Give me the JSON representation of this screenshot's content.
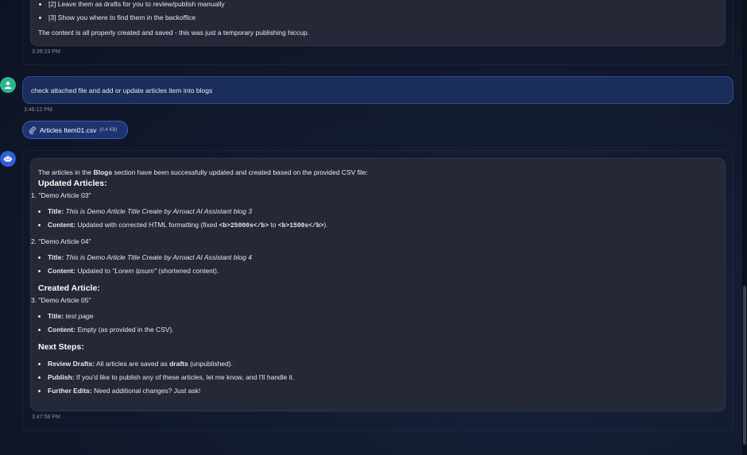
{
  "prev_message": {
    "bullet_2": "[2] Leave them as drafts for you to review/publish manually",
    "bullet_3": "[3] Show you where to find them in the backoffice",
    "summary": "The content is all properly created and saved - this was just a temporary publishing hiccup.",
    "timestamp": "3:39:23 PM"
  },
  "user_message": {
    "text": "check attached file and add or update articles item into blogs",
    "timestamp": "3:46:12 PM",
    "attachment": {
      "name": "Articles Item01.csv",
      "size": "(0.4 KB)"
    }
  },
  "bot_message": {
    "intro_pre": "The articles in the ",
    "intro_bold": "Blogs",
    "intro_post": " section have been successfully updated and created based on the provided CSV file:",
    "updated_heading": "Updated Articles:",
    "article1": {
      "label": "1. \"Demo Article 03\"",
      "title_label": "Title:",
      "title_value": "This is Demo Article Title Create by Arroact AI Assistant blog 3",
      "content_label": "Content:",
      "content_pre": "Updated with corrected HTML formatting (fixed ",
      "code1": "<b>25000s</b>",
      "content_mid": " to ",
      "code2": "<b>1500s</b>",
      "content_post": ")."
    },
    "article2": {
      "label": "2. \"Demo Article 04\"",
      "title_label": "Title:",
      "title_value": "This is Demo Article Title Create by Arroact AI Assistant blog 4",
      "content_label": "Content:",
      "content_pre": "Updated to ",
      "content_italic": "\"Lorem Ipsum\"",
      "content_post": " (shortened content)."
    },
    "created_heading": "Created Article:",
    "article3": {
      "label": "3. \"Demo Article 05\"",
      "title_label": "Title:",
      "title_value": "test page",
      "content_label": "Content:",
      "content_value": "Empty (as provided in the CSV)."
    },
    "next_heading": "Next Steps:",
    "steps": [
      {
        "label": "Review Drafts:",
        "pre": "All articles are saved as ",
        "bold": "drafts",
        "post": " (unpublished)."
      },
      {
        "label": "Publish:",
        "pre": "If you'd like to publish any of these articles, let me know, and I'll handle it.",
        "bold": "",
        "post": ""
      },
      {
        "label": "Further Edits:",
        "pre": "Need additional changes? Just ask!",
        "bold": "",
        "post": ""
      }
    ],
    "timestamp": "3:47:58 PM"
  },
  "colors": {
    "user_avatar": "#2bb58a",
    "bot_avatar": "#2f5fd6",
    "user_bubble": "#1b2d5a",
    "attachment_bg": "#1e3470"
  }
}
